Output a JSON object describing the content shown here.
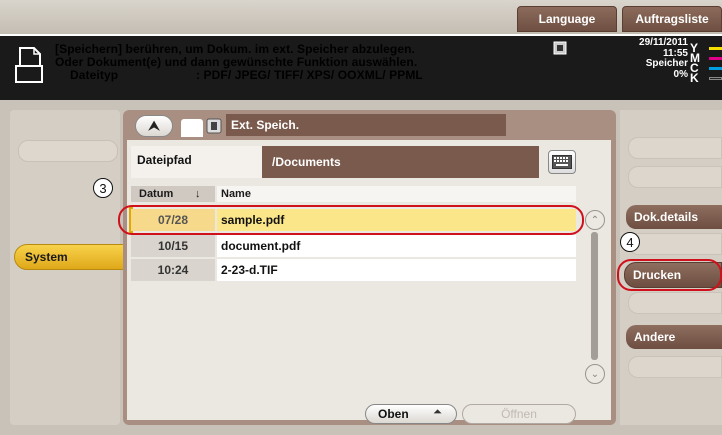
{
  "top_bar": {
    "language_label": "Language",
    "jobs_label": "Auftragsliste"
  },
  "message": {
    "line1": "[Speichern] berühren, um Dokum. im ext. Speicher abzulegen.",
    "line2": "Oder Dokument(e) und dann gewünschte Funktion auswählen.",
    "filetype_label": "Dateityp",
    "filetype_value": ": PDF/ JPEG/ TIFF/ XPS/ OOXML/ PPML"
  },
  "status": {
    "date": "29/11/2011",
    "time": "11:55",
    "storage_label": "Speicher",
    "storage_value": "0%",
    "toner_letters": [
      "Y",
      "M",
      "C",
      "K"
    ]
  },
  "left": {
    "ghost_label": "",
    "system_label": "System"
  },
  "browser": {
    "location_label": "Ext. Speich.",
    "path_label": "Dateipfad",
    "path_value": "/Documents",
    "col_date": "Datum",
    "col_date_sort": "↓",
    "col_name": "Name",
    "files": [
      {
        "date": "07/28",
        "name": "sample.pdf",
        "selected": true
      },
      {
        "date": "10/15",
        "name": "document.pdf",
        "selected": false
      },
      {
        "date": "10:24",
        "name": "2-23-d.TIF",
        "selected": false
      }
    ],
    "top_label": "Oben",
    "open_label": "Öffnen"
  },
  "right": {
    "doc_details_label": "Dok.details",
    "print_label": "Drucken",
    "other_label": "Andere"
  },
  "callouts": {
    "step3": "3",
    "step4": "4"
  },
  "colors": {
    "accent_yellow": "#f0c030",
    "brown": "#7a5a4c",
    "ring_red": "#d0101a"
  },
  "icons": [
    "document-icon",
    "usb-storage-icon",
    "keyboard-icon",
    "up-arrow-icon",
    "scroll-up-icon",
    "scroll-down-icon"
  ]
}
